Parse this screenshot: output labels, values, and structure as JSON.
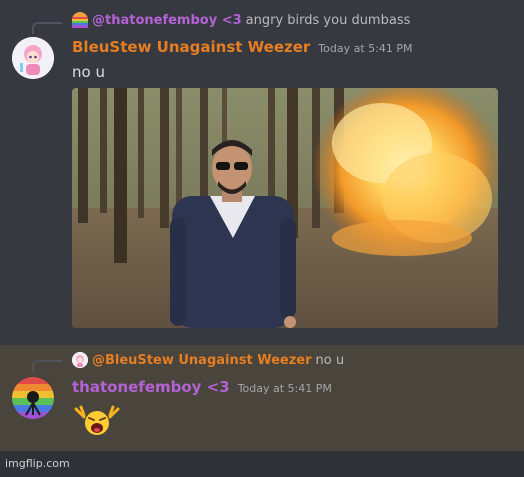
{
  "messages": [
    {
      "reply": {
        "name": "@thatonefemboy <3",
        "text": "angry birds you dumbass",
        "name_color": "#b463d6"
      },
      "author": "BleuStew Unagainst Weezer",
      "author_color": "#e67e22",
      "timestamp": "Today at 5:41 PM",
      "content": "no u",
      "attachment": "gif-explosion-walking-man"
    },
    {
      "reply": {
        "name": "@BleuStew Unagainst Weezer",
        "text": "no u",
        "name_color": "#e67e22"
      },
      "author": "thatonefemboy <3",
      "author_color": "#b463d6",
      "timestamp": "Today at 5:41 PM",
      "emoji": "crying-angry-emoji"
    }
  ],
  "footer": {
    "watermark": "imgflip.com"
  },
  "colors": {
    "background": "#36393f",
    "highlight": "#49443c",
    "footer": "#2f3136"
  }
}
